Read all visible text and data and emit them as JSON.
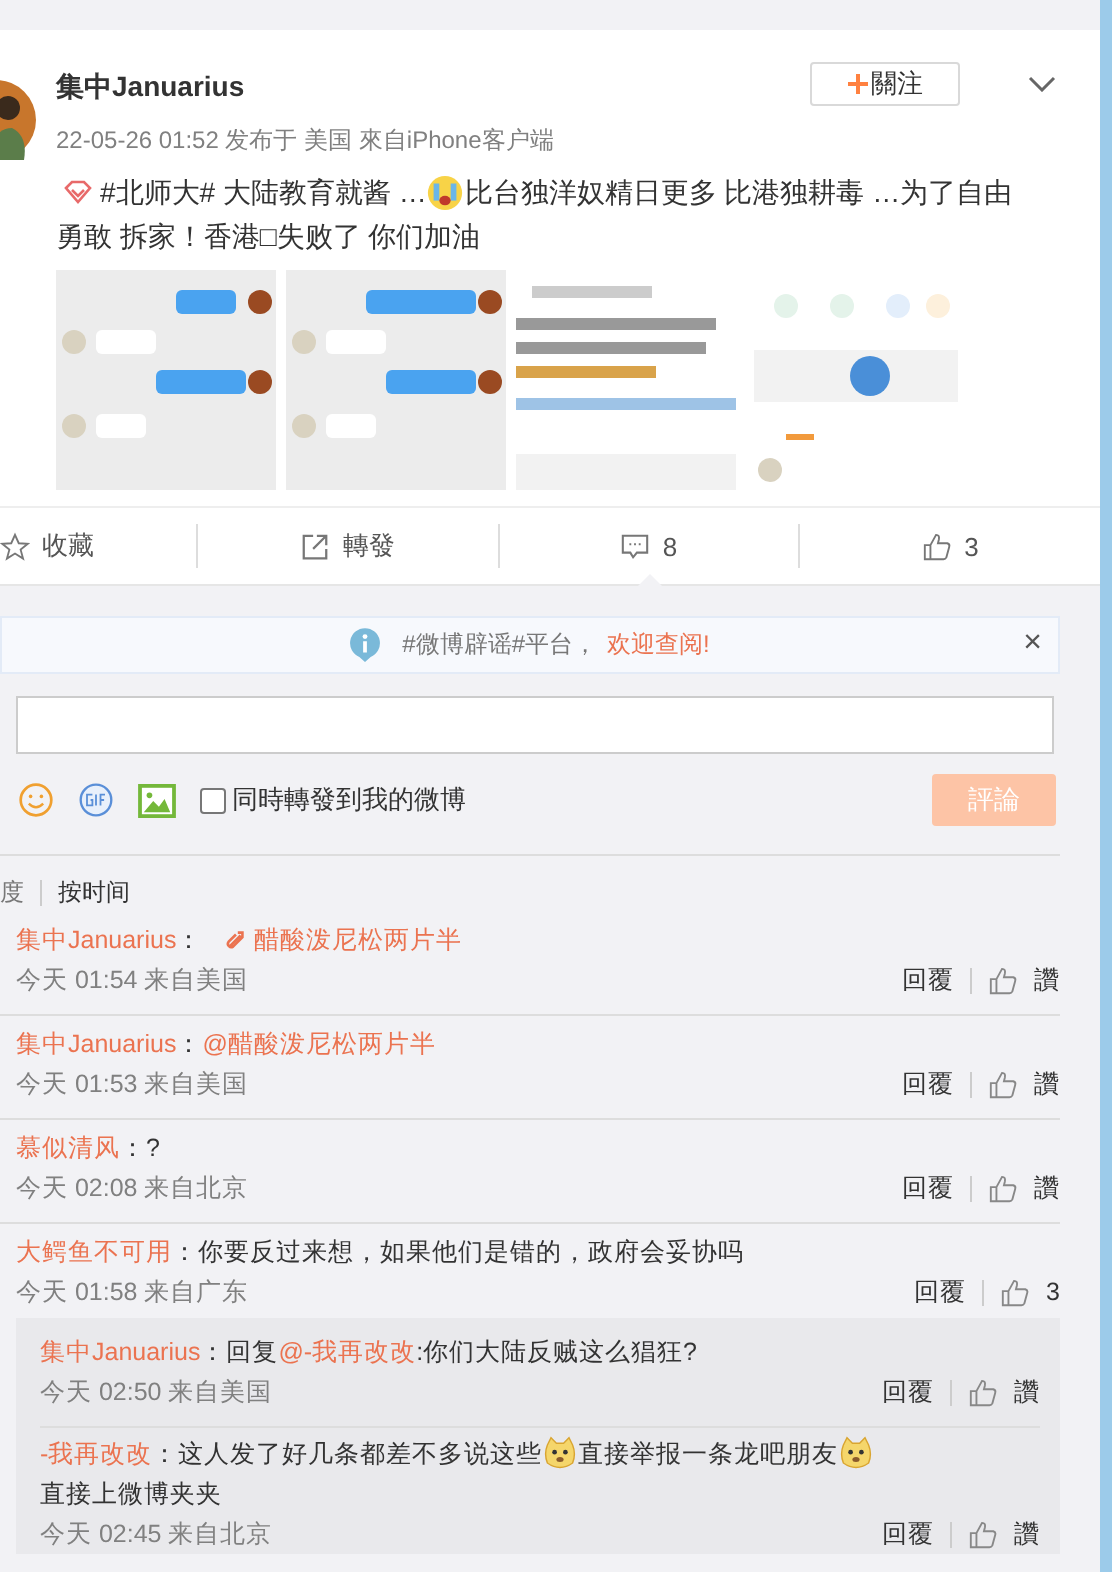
{
  "post": {
    "author": "集中Januarius",
    "follow_label": "關注",
    "meta": "22-05-26 01:52 发布于 美国 來自iPhone客户端",
    "text_lines": [
      [
        {
          "kind": "topic-icon"
        },
        {
          "kind": "text",
          "text": "#北师大# 大陆教育就酱 …"
        },
        {
          "kind": "emoji"
        },
        {
          "kind": "text",
          "text": "比台独洋奴精日更多 比港独耕毒 …为了自由"
        }
      ],
      [
        {
          "kind": "text",
          "text": "勇敢 拆家！香港□失败了 你们加油"
        }
      ]
    ],
    "images": [
      {
        "kind": "picture"
      },
      {
        "kind": "picture"
      },
      {
        "kind": "picture"
      },
      {
        "kind": "picture"
      }
    ]
  },
  "actions": [
    {
      "kind": "favorite",
      "label": "收藏",
      "selected": false
    },
    {
      "kind": "repost",
      "label": "轉發",
      "selected": false
    },
    {
      "kind": "comment",
      "label": "8",
      "selected": true
    },
    {
      "kind": "like",
      "label": "3",
      "selected": false
    }
  ],
  "notice": {
    "text": "#微博辟谣#平台，",
    "link": "欢迎查阅!",
    "close": "×"
  },
  "composer": {
    "repost_label": "同時轉發到我的微博",
    "repost_checked": false,
    "submit": "評論"
  },
  "sort": [
    {
      "label": "度",
      "selected": false
    },
    {
      "label": "按时间",
      "selected": true
    }
  ],
  "comments": [
    {
      "user": "集中Januarius",
      "colon": "：",
      "parts": [
        {
          "kind": "link",
          "text": "醋酸泼尼松两片半"
        }
      ],
      "time": "今天 01:54 来自美国",
      "reply": "回覆",
      "likes": "讚"
    },
    {
      "user": "集中Januarius",
      "colon": "：",
      "parts": [
        {
          "kind": "mention",
          "text": "@醋酸泼尼松两片半"
        }
      ],
      "time": "今天 01:53 来自美国",
      "reply": "回覆",
      "likes": "讚"
    },
    {
      "user": "慕似清风",
      "colon": "：",
      "parts": [
        {
          "kind": "text",
          "text": "?"
        }
      ],
      "time": "今天 02:08 来自北京",
      "reply": "回覆",
      "likes": "讚"
    },
    {
      "user": "大鳄鱼不可用",
      "colon": "：",
      "parts": [
        {
          "kind": "text",
          "text": "你要反过来想，如果他们是错的，政府会妥协吗"
        }
      ],
      "time": "今天 01:58 来自广东",
      "reply": "回覆",
      "likes": "3",
      "replies": [
        {
          "user": "集中Januarius",
          "colon": "：",
          "parts": [
            {
              "kind": "text",
              "text": "回复"
            },
            {
              "kind": "mention",
              "text": "@-我再改改"
            },
            {
              "kind": "text",
              "text": ":你们大陆反贼这么猖狂?"
            }
          ],
          "time": "今天 02:50 来自美国",
          "reply": "回覆",
          "likes": "讚"
        },
        {
          "user": "-我再改改",
          "colon": "：",
          "parts": [
            {
              "kind": "text",
              "text": "这人发了好几条都差不多说这些"
            },
            {
              "kind": "emoji"
            },
            {
              "kind": "text",
              "text": "直接举报一条龙吧朋友"
            },
            {
              "kind": "emoji"
            },
            {
              "kind": "text",
              "text": "直接上微博夹夹"
            }
          ],
          "time": "今天 02:45 来自北京",
          "reply": "回覆",
          "likes": "讚"
        }
      ]
    }
  ]
}
